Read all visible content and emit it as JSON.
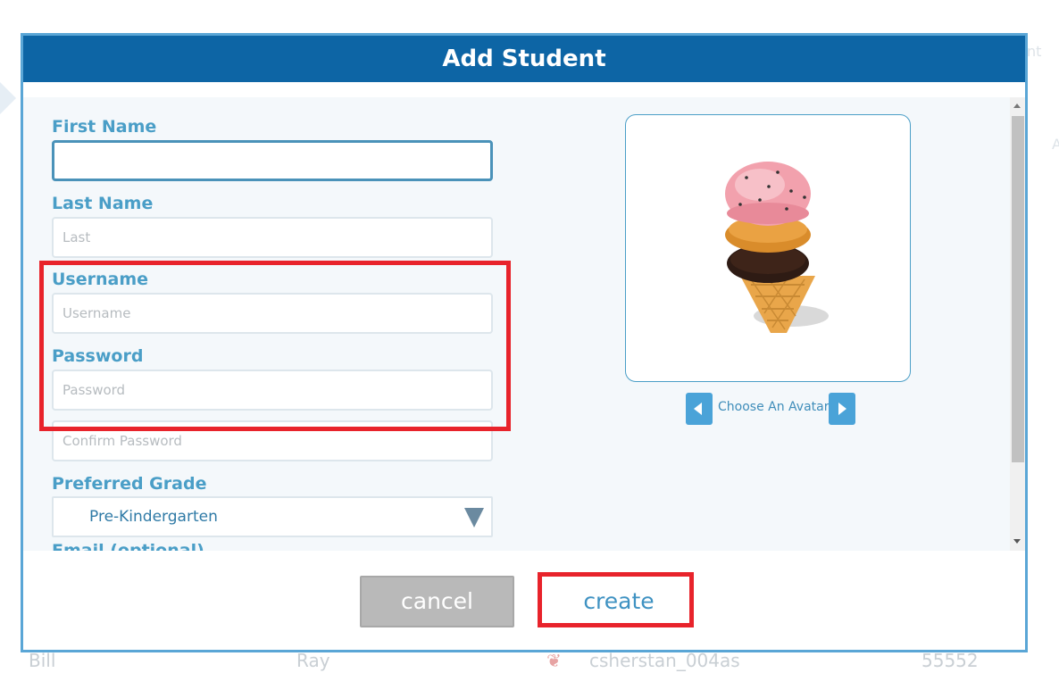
{
  "background": {
    "row": {
      "first": "Bill",
      "last": "Ray",
      "username": "csherstan_004as",
      "number": "55552"
    }
  },
  "modal": {
    "title": "Add Student",
    "fields": {
      "first_name": {
        "label": "First Name",
        "value": "",
        "placeholder": ""
      },
      "last_name": {
        "label": "Last Name",
        "placeholder": "Last"
      },
      "username": {
        "label": "Username",
        "placeholder": "Username"
      },
      "password": {
        "label": "Password",
        "placeholder": "Password"
      },
      "confirm_password": {
        "placeholder": "Confirm Password"
      },
      "preferred_grade": {
        "label": "Preferred Grade",
        "selected": "Pre-Kindergarten"
      },
      "email": {
        "label": "Email (optional)"
      }
    },
    "avatar": {
      "icon": "ice-cream-cone-avatar",
      "choose_label": "Choose An Avatar"
    },
    "buttons": {
      "cancel": "cancel",
      "create": "create"
    }
  },
  "colors": {
    "header": "#0d65a5",
    "label": "#4a9ec7",
    "highlight": "#e8232b",
    "cancel": "#b9b9b9"
  }
}
